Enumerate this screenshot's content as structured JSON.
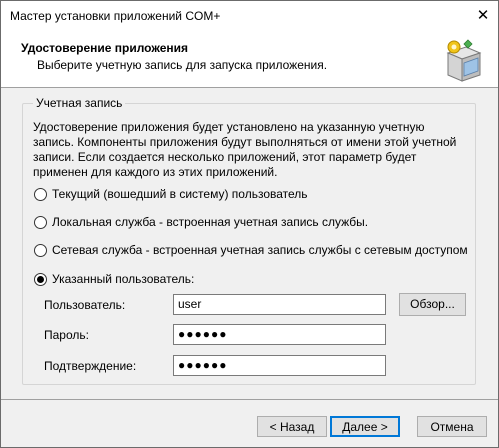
{
  "window": {
    "title": "Мастер установки приложений COM+",
    "close_glyph": "✕"
  },
  "header": {
    "title": "Удостоверение приложения",
    "subtitle": "Выберите учетную запись для запуска приложения.",
    "icon": "package-wizard-icon"
  },
  "account_group": {
    "label": "Учетная запись",
    "description": "Удостоверение приложения будет установлено на указанную учетную запись. Компоненты приложения будут выполняться от имени этой учетной записи.  Если создается несколько приложений, этот параметр будет применен для каждого из этих приложений.",
    "options": [
      {
        "label": "Текущий (вошедший в систему) пользователь",
        "checked": false
      },
      {
        "label": "Локальная служба - встроенная учетная запись службы.",
        "checked": false
      },
      {
        "label": "Сетевая служба - встроенная учетная запись службы с сетевым доступом",
        "checked": false
      },
      {
        "label": "Указанный пользователь:",
        "checked": true
      }
    ],
    "fields": {
      "user_label": "Пользователь:",
      "user_value": "user",
      "browse_label": "Обзор...",
      "password_label": "Пароль:",
      "password_value": "●●●●●●",
      "confirm_label": "Подтверждение:",
      "confirm_value": "●●●●●●"
    }
  },
  "footer": {
    "back_label": "< Назад",
    "next_label": "Далее >",
    "cancel_label": "Отмена"
  }
}
